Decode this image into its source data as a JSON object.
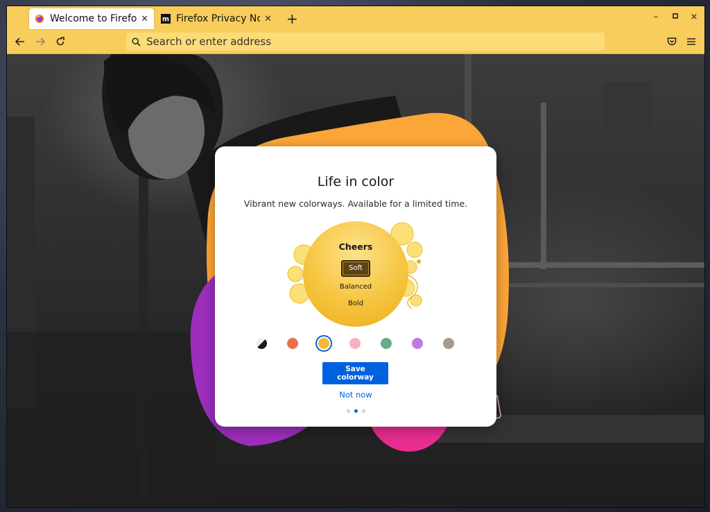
{
  "tabs": [
    {
      "title": "Welcome to Firefox",
      "active": true,
      "icon": "firefox-logo-icon"
    },
    {
      "title": "Firefox Privacy Notice",
      "active": false,
      "icon": "mozilla-m-icon"
    }
  ],
  "toolbar": {
    "back_icon": "arrow-left-icon",
    "forward_icon": "arrow-right-icon",
    "reload_icon": "reload-icon",
    "search_placeholder": "Search or enter address",
    "pocket_icon": "pocket-icon",
    "menu_icon": "hamburger-menu-icon"
  },
  "window_controls": {
    "minimize": "–",
    "maximize": "▫",
    "close": "×"
  },
  "card": {
    "title": "Life in color",
    "subtitle": "Vibrant new colorways. Available for a limited time.",
    "colorway_name": "Cheers",
    "variations": [
      "Soft",
      "Balanced",
      "Bold"
    ],
    "selected_variation": "Soft",
    "swatches": [
      {
        "name": "default",
        "color": "#1c1b22"
      },
      {
        "name": "red",
        "color": "#e8704f"
      },
      {
        "name": "yellow",
        "color": "#f2b93a",
        "selected": true
      },
      {
        "name": "pink",
        "color": "#f4b2c0"
      },
      {
        "name": "green",
        "color": "#6aa88a"
      },
      {
        "name": "purple",
        "color": "#c07ae0"
      },
      {
        "name": "beige",
        "color": "#a69a8a"
      }
    ],
    "primary_button": "Save colorway",
    "secondary_link": "Not now",
    "steps_total": 3,
    "step_current": 2
  },
  "colors": {
    "toolbar": "#f9cd5c",
    "urlbar": "#fcdc78",
    "accent": "#0061e0",
    "blob_orange": "#fda638",
    "blob_purple": "#9d2ebb",
    "blob_pink": "#e82d8f"
  }
}
